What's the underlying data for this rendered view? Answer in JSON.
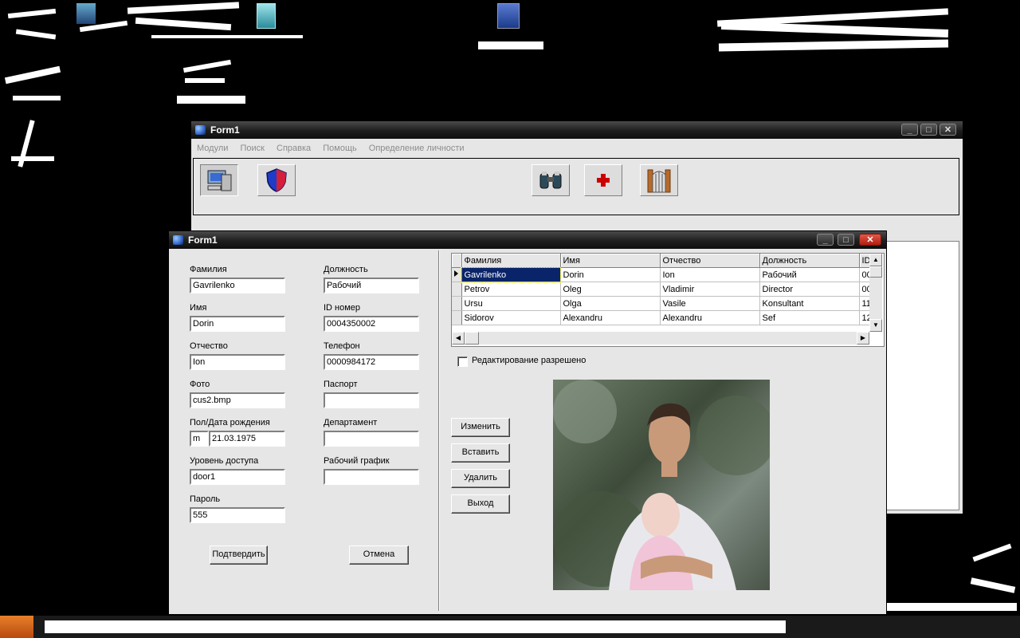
{
  "back_window": {
    "title": "Form1",
    "menu": [
      "Модули",
      "Поиск",
      "Справка",
      "Помощь",
      "Определение личности"
    ]
  },
  "front_window": {
    "title": "Form1",
    "form": {
      "surname_label": "Фамилия",
      "surname_value": "Gavrilenko",
      "name_label": "Имя",
      "name_value": "Dorin",
      "patronymic_label": "Отчество",
      "patronymic_value": "Ion",
      "photo_label": "Фото",
      "photo_value": "cus2.bmp",
      "gender_birth_label": "Пол/Дата рождения",
      "gender_value": "m",
      "birth_value": "21.03.1975",
      "access_label": "Уровень доступа",
      "access_value": "door1",
      "password_label": "Пароль",
      "password_value": "555",
      "position_label": "Должность",
      "position_value": "Рабочий",
      "id_label": "ID номер",
      "id_value": "0004350002",
      "phone_label": "Телефон",
      "phone_value": "0000984172",
      "passport_label": "Паспорт",
      "passport_value": "",
      "department_label": "Департамент",
      "department_value": "",
      "schedule_label": "Рабочий график",
      "schedule_value": "",
      "confirm_button": "Подтвердить",
      "cancel_button": "Отмена"
    },
    "grid": {
      "columns": [
        "Фамилия",
        "Имя",
        "Отчество",
        "Должность",
        "ID"
      ],
      "rows": [
        [
          "Gavrilenko",
          "Dorin",
          "Ion",
          "Рабочий",
          "00"
        ],
        [
          "Petrov",
          "Oleg",
          "Vladimir",
          "Director",
          "00"
        ],
        [
          "Ursu",
          "Olga",
          "Vasile",
          "Konsultant",
          "11"
        ],
        [
          "Sidorov",
          "Alexandru",
          "Alexandru",
          "Sef",
          "12"
        ]
      ]
    },
    "edit_checkbox_label": "Редактирование разрешено",
    "edit_checkbox_checked": false,
    "actions": {
      "change": "Изменить",
      "insert": "Вставить",
      "delete": "Удалить",
      "exit": "Выход"
    }
  }
}
